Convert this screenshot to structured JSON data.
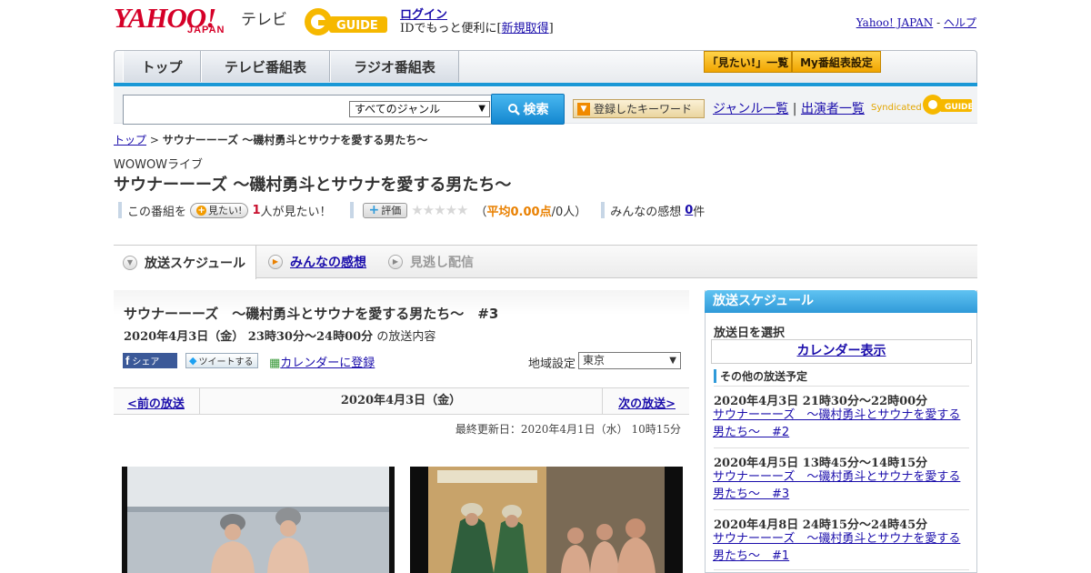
{
  "header": {
    "yahoo_logo": "YAHOO!",
    "yahoo_sub": "JAPAN",
    "tv_label": "テレビ",
    "gguide_logo": "G-GUIDE",
    "login_label": "ログイン",
    "id_prefix": "IDでもっと便利に[",
    "register_label": "新規取得",
    "id_suffix": "]",
    "yahoo_japan_link": "Yahoo! JAPAN",
    "separator": "-",
    "help_link": "ヘルプ"
  },
  "nav": {
    "tabs": [
      "トップ",
      "テレビ番組表",
      "ラジオ番組表"
    ],
    "want_list_label": "「見たい!」一覧",
    "my_schedule_label": "My番組表設定"
  },
  "search": {
    "genre_selected": "すべてのジャンル",
    "button_label": "検索",
    "keyword_button_label": "登録したキーワード",
    "genre_list_link": "ジャンル一覧",
    "divider": "|",
    "performer_list_link": "出演者一覧",
    "syndicated_label": "Syndicated",
    "syndicated_logo": "GUIDE"
  },
  "breadcrumb": {
    "top": "トップ",
    "sep": ">",
    "current": "サウナーーーズ ～磯村勇斗とサウナを愛する男たち～"
  },
  "program": {
    "channel": "WOWOWライブ",
    "title": "サウナーーーズ ～磯村勇斗とサウナを愛する男たち～",
    "this_program": "この番組を",
    "want_button": "見たい!",
    "want_count": "1",
    "want_suffix": "人が見たい！",
    "rate_button": "評価",
    "rating_open": "（",
    "rating_avg": "平均0.00点",
    "rating_people": "/0人）",
    "impressions_label": "みんなの感想",
    "impressions_count": "0",
    "impressions_unit": "件"
  },
  "content_tabs": {
    "schedule": "放送スケジュール",
    "impressions": "みんなの感想",
    "missed": "見逃し配信"
  },
  "episode": {
    "title": "サウナーーーズ　～磯村勇斗とサウナを愛する男たち～　#3",
    "datetime": "2020年4月3日（金） 23時30分～24時00分",
    "datetime_suffix": "の放送内容",
    "share_label": "シェア",
    "share_f": "f",
    "tweet_label": "ツイートする",
    "calendar_label": "カレンダーに登録",
    "region_label": "地域設定",
    "region_selected": "東京",
    "prev_label": "<前の放送",
    "date_label": "2020年4月3日（金）",
    "next_label": "次の放送>",
    "updated": "最終更新日：2020年4月1日（水） 10時15分"
  },
  "sidebar": {
    "header": "放送スケジュール",
    "date_select_label": "放送日を選択",
    "calendar_button": "カレンダー表示",
    "other_schedule_label": "その他の放送予定",
    "schedules": [
      {
        "time": "2020年4月3日 21時30分～22時00分",
        "title": "サウナーーーズ　～磯村勇斗とサウナを愛する男たち～　#2"
      },
      {
        "time": "2020年4月5日 13時45分～14時15分",
        "title": "サウナーーーズ　～磯村勇斗とサウナを愛する男たち～　#3"
      },
      {
        "time": "2020年4月8日 24時15分～24時45分",
        "title": "サウナーーーズ　～磯村勇斗とサウナを愛する男たち～　#1"
      }
    ]
  },
  "colors": {
    "accent_blue": "#1a98d6",
    "yahoo_red": "#d50028",
    "want_count_red": "#c8102e",
    "rating_orange": "#e98000"
  },
  "icons": {
    "search": "magnifier-icon",
    "nav_arrow": "triangle-icon"
  }
}
